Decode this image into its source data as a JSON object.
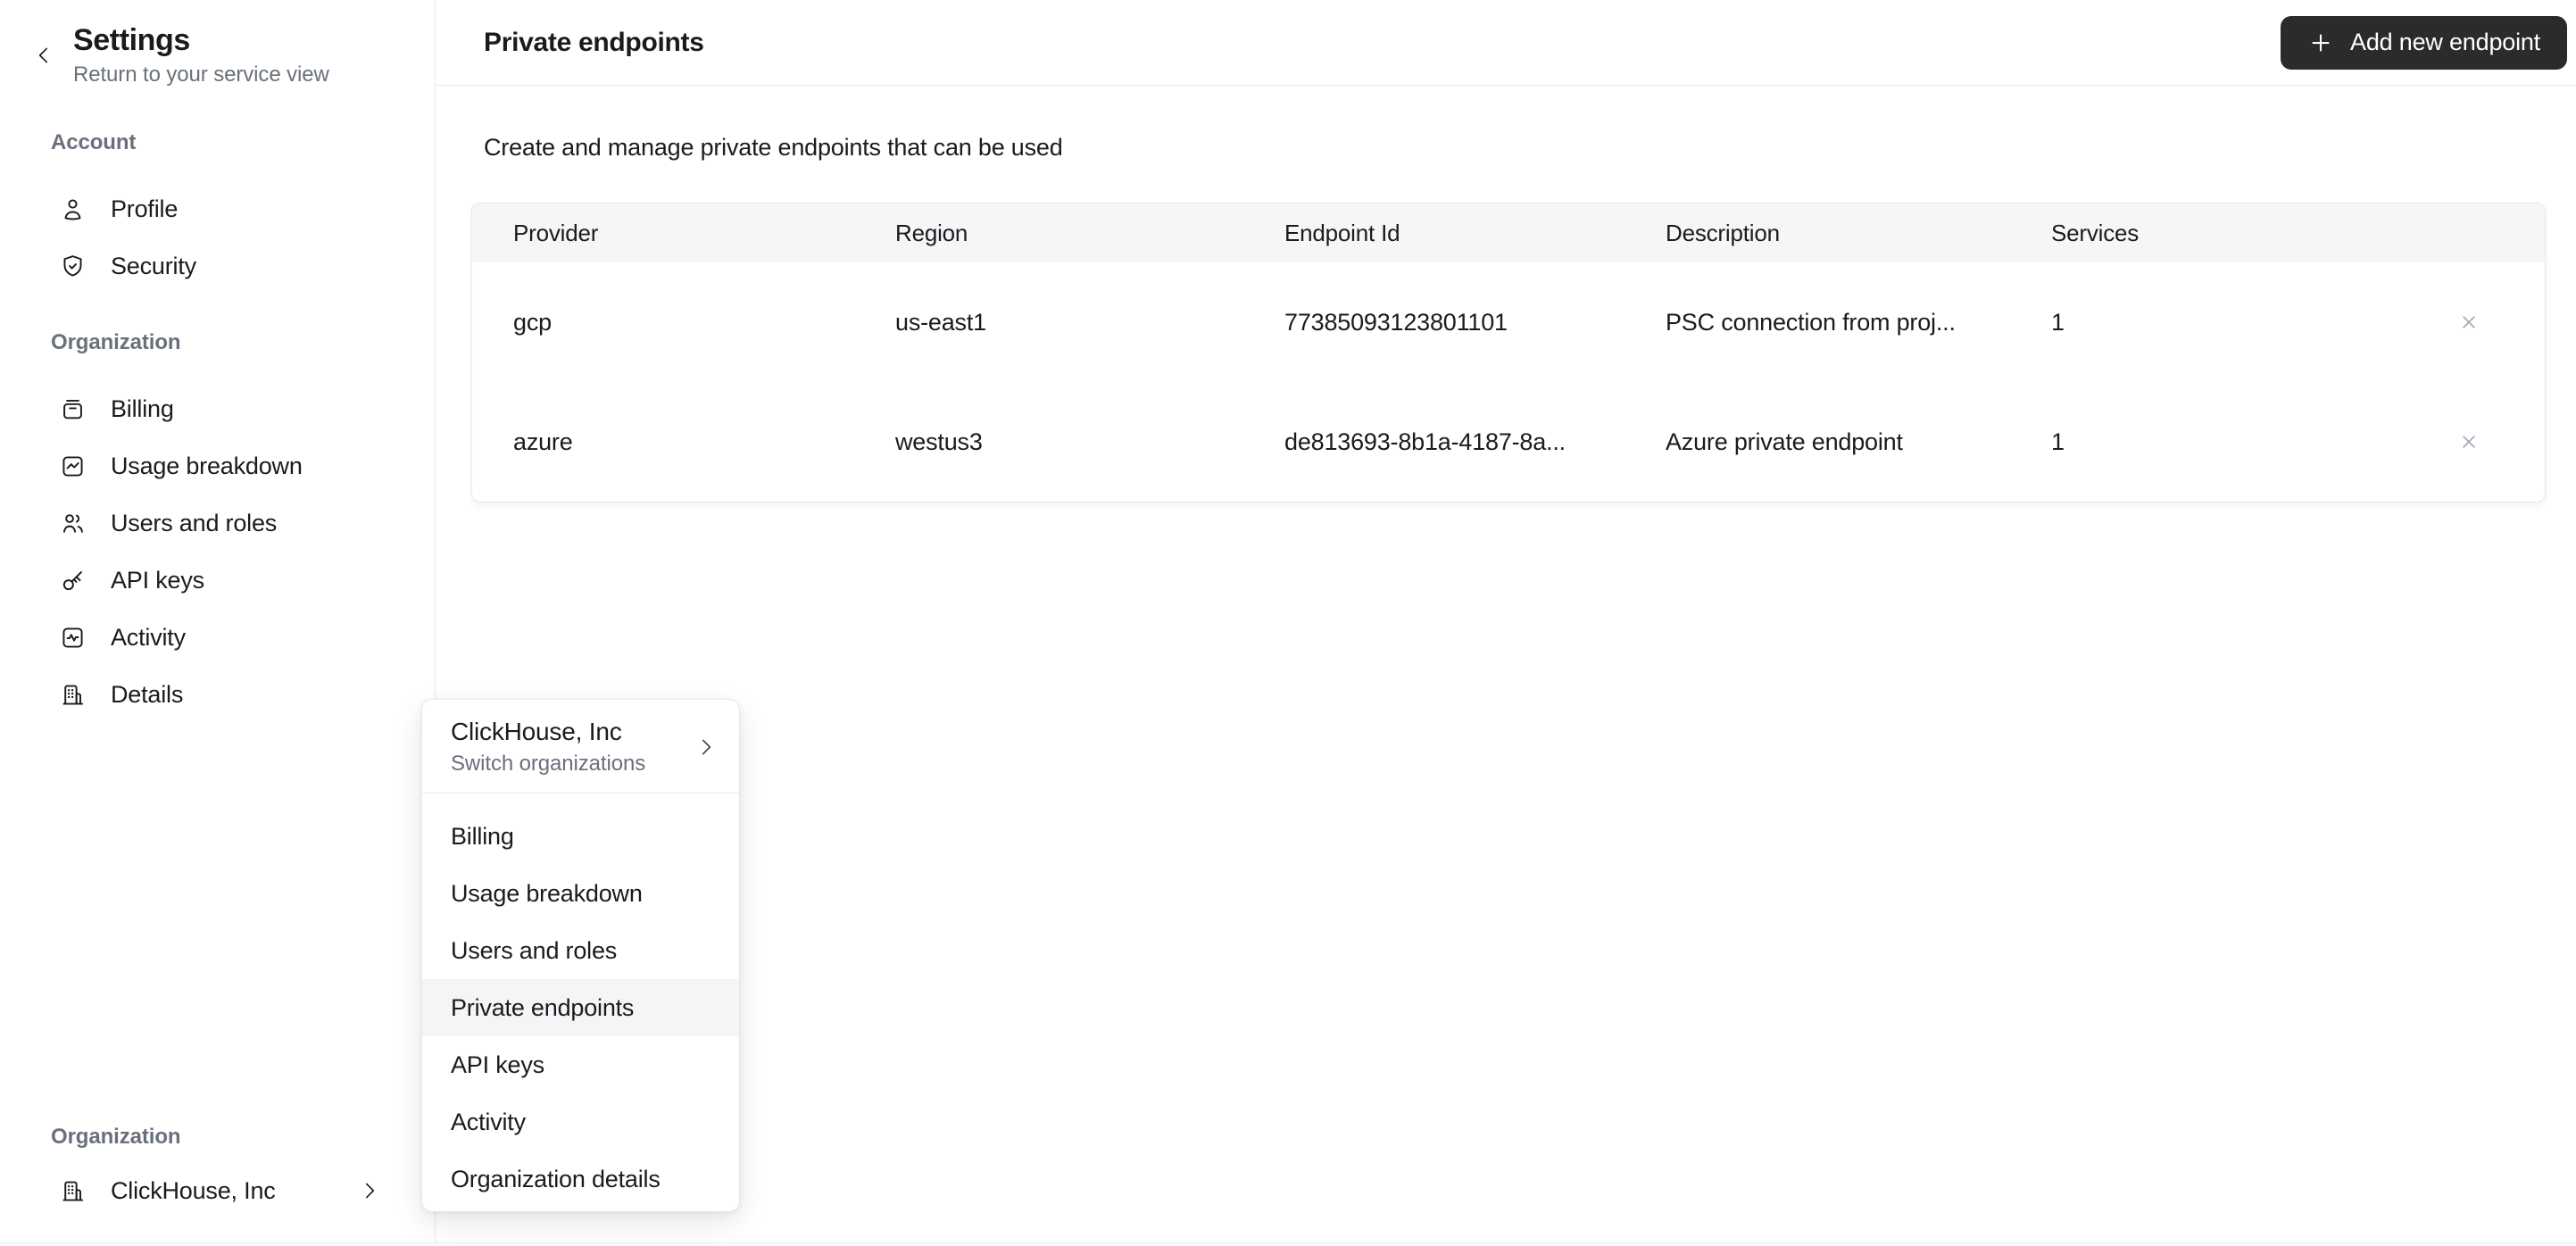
{
  "sidebar": {
    "title": "Settings",
    "subtitle": "Return to your service view",
    "sections": [
      {
        "label": "Account",
        "items": [
          {
            "label": "Profile",
            "icon": "user-icon"
          },
          {
            "label": "Security",
            "icon": "shield-check-icon"
          }
        ]
      },
      {
        "label": "Organization",
        "items": [
          {
            "label": "Billing",
            "icon": "billing-icon"
          },
          {
            "label": "Usage breakdown",
            "icon": "usage-chart-icon"
          },
          {
            "label": "Users and roles",
            "icon": "users-icon"
          },
          {
            "label": "API keys",
            "icon": "key-icon"
          },
          {
            "label": "Activity",
            "icon": "activity-icon"
          },
          {
            "label": "Details",
            "icon": "building-icon"
          }
        ]
      }
    ],
    "footer": {
      "label": "Organization",
      "org_name": "ClickHouse, Inc"
    }
  },
  "header": {
    "title": "Private endpoints",
    "add_button": "Add new endpoint"
  },
  "main": {
    "intro": "Create and manage private endpoints that can be used",
    "table": {
      "columns": [
        "Provider",
        "Region",
        "Endpoint Id",
        "Description",
        "Services"
      ],
      "rows": [
        {
          "provider": "gcp",
          "region": "us-east1",
          "endpoint_id": "77385093123801101",
          "description": "PSC connection from proj...",
          "services": "1"
        },
        {
          "provider": "azure",
          "region": "westus3",
          "endpoint_id": "de813693-8b1a-4187-8a...",
          "description": "Azure private endpoint",
          "services": "1"
        }
      ]
    }
  },
  "menu": {
    "org_name": "ClickHouse, Inc",
    "org_subtitle": "Switch organizations",
    "items": [
      {
        "label": "Billing",
        "highlighted": false
      },
      {
        "label": "Usage breakdown",
        "highlighted": false
      },
      {
        "label": "Users and roles",
        "highlighted": false
      },
      {
        "label": "Private endpoints",
        "highlighted": true
      },
      {
        "label": "API keys",
        "highlighted": false
      },
      {
        "label": "Activity",
        "highlighted": false
      },
      {
        "label": "Organization details",
        "highlighted": false
      }
    ]
  },
  "colors": {
    "text": "#1b1b1d",
    "muted_text": "#69707b",
    "border": "#e7e8ec",
    "table_header_bg": "#f5f6f8",
    "menu_highlight_bg": "#f4f5f7",
    "button_bg": "#2b2b2e",
    "button_text": "#ffffff",
    "close_icon": "#9ca3af"
  }
}
